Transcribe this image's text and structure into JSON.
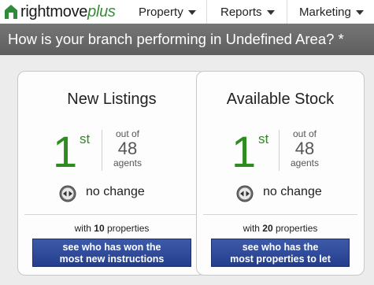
{
  "nav": {
    "logo_main": "rightmove",
    "logo_plus": "plus",
    "items": [
      {
        "label": "Property"
      },
      {
        "label": "Reports"
      },
      {
        "label": "Marketing"
      }
    ]
  },
  "banner": {
    "text": "How is your branch performing in Undefined Area? *"
  },
  "cards": [
    {
      "title": "New Listings",
      "rank": "1",
      "rank_suffix": "st",
      "out_of_label": "out of",
      "out_of_value": "48",
      "agents_label": "agents",
      "change_text": "no change",
      "with_prefix": "with",
      "with_count": "10",
      "with_suffix": "properties",
      "cta_line1": "see who has won the",
      "cta_line2": "most new instructions"
    },
    {
      "title": "Available Stock",
      "rank": "1",
      "rank_suffix": "st",
      "out_of_label": "out of",
      "out_of_value": "48",
      "agents_label": "agents",
      "change_text": "no change",
      "with_prefix": "with",
      "with_count": "20",
      "with_suffix": "properties",
      "cta_line1": "see who has the",
      "cta_line2": "most properties to let"
    }
  ],
  "colors": {
    "rank_green": "#2e8b1f",
    "banner_gray": "#6a6a6a",
    "cta_blue": "#2f4b9a"
  }
}
